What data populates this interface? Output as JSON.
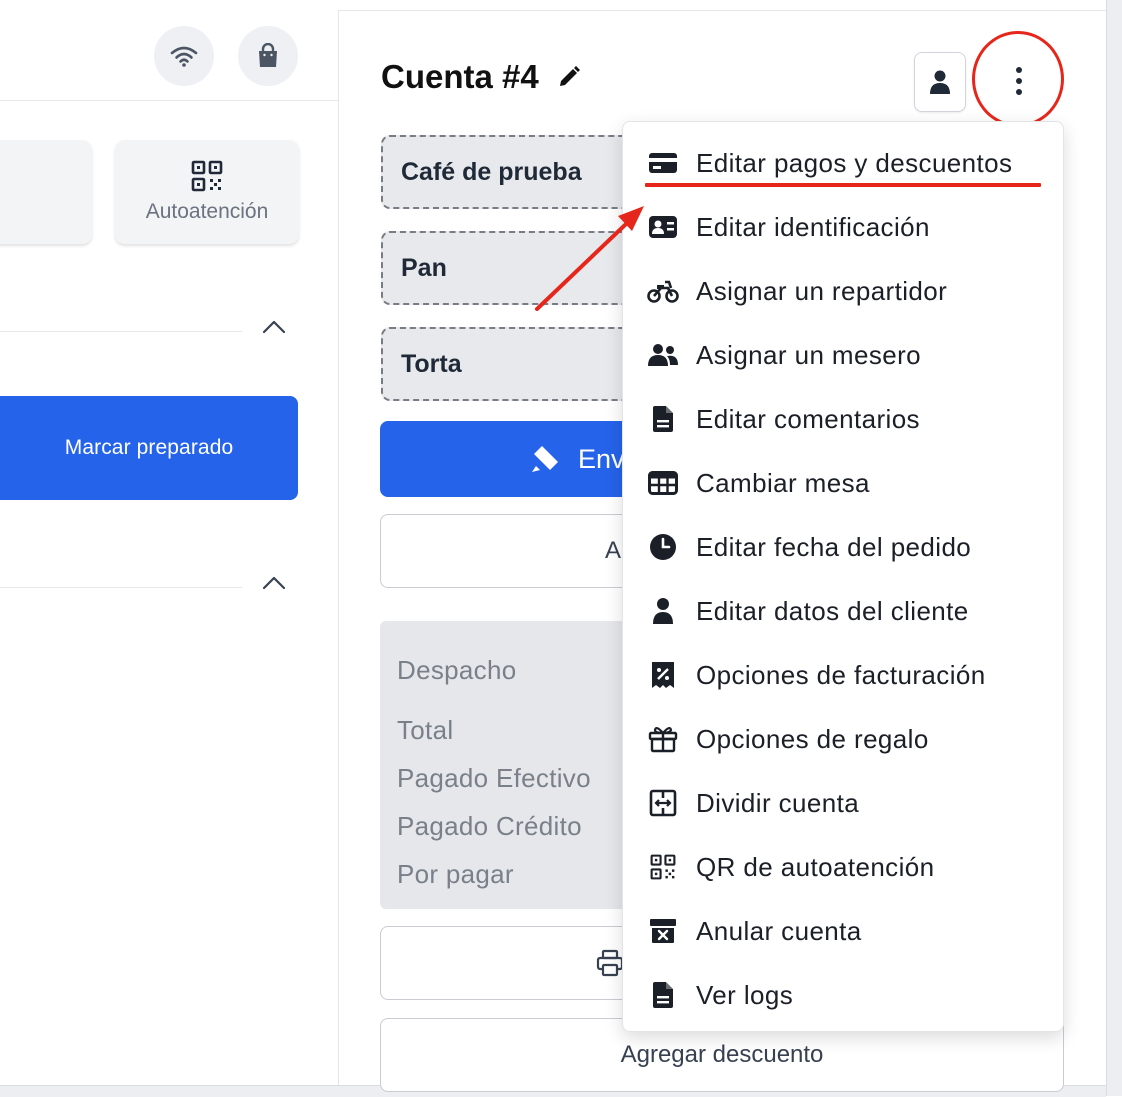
{
  "left_panel": {
    "self_service_tile_label": "Autoatención",
    "mark_ready_label": "Marcar preparado"
  },
  "account": {
    "title": "Cuenta #4"
  },
  "items": [
    "Café de prueba",
    "Pan",
    "Torta"
  ],
  "send_button_label": "Env",
  "secondary_button_letter": "A",
  "summary": {
    "dispatch_label": "Despacho",
    "total_label": "Total",
    "paid_cash_label": "Pagado Efectivo",
    "paid_credit_label": "Pagado Crédito",
    "to_pay_label": "Por pagar"
  },
  "add_discount_label": "Agregar descuento",
  "menu": {
    "items": [
      {
        "label": "Editar pagos y descuentos",
        "icon": "credit-card-icon"
      },
      {
        "label": "Editar identificación",
        "icon": "id-card-icon"
      },
      {
        "label": "Asignar un repartidor",
        "icon": "motorcycle-icon"
      },
      {
        "label": "Asignar un mesero",
        "icon": "users-icon"
      },
      {
        "label": "Editar comentarios",
        "icon": "document-icon"
      },
      {
        "label": "Cambiar mesa",
        "icon": "table-icon"
      },
      {
        "label": "Editar fecha del pedido",
        "icon": "clock-icon"
      },
      {
        "label": "Editar datos del cliente",
        "icon": "person-icon"
      },
      {
        "label": "Opciones de facturación",
        "icon": "receipt-percent-icon"
      },
      {
        "label": "Opciones de regalo",
        "icon": "gift-icon"
      },
      {
        "label": "Dividir cuenta",
        "icon": "split-icon"
      },
      {
        "label": "QR de autoatención",
        "icon": "qr-code-icon"
      },
      {
        "label": "Anular cuenta",
        "icon": "archive-x-icon"
      },
      {
        "label": "Ver logs",
        "icon": "document-icon"
      }
    ]
  },
  "colors": {
    "primary_blue": "#2563eb",
    "annotation_red": "#e7261b",
    "summary_bg": "#e5e7eb",
    "item_card_bg": "#e8e9ec"
  }
}
